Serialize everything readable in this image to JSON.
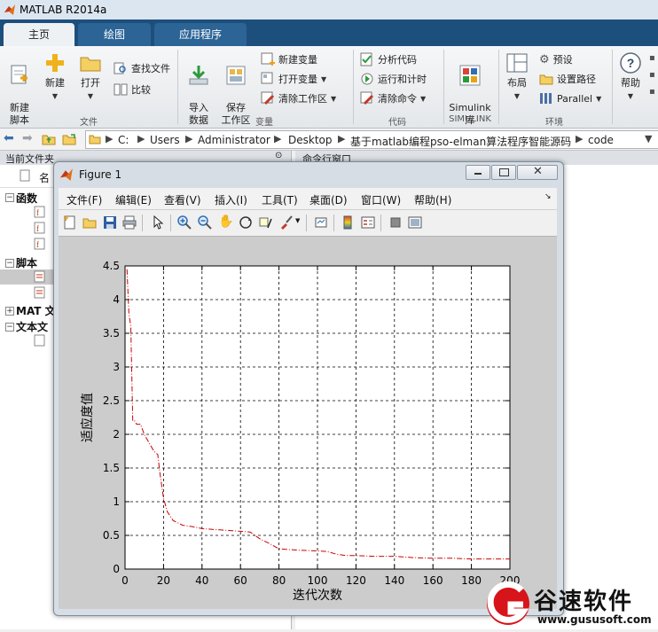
{
  "app": {
    "title": "MATLAB R2014a"
  },
  "tabs": [
    {
      "label": "主页",
      "active": true
    },
    {
      "label": "绘图",
      "active": false
    },
    {
      "label": "应用程序",
      "active": false
    }
  ],
  "ribbon": {
    "file_group": {
      "new_script": "新建\n脚本",
      "new": "新建",
      "open": "打开",
      "find_files": "查找文件",
      "compare": "比较",
      "section": "文件"
    },
    "variable_group": {
      "import_data": "导入\n数据",
      "save_workspace": "保存\n工作区",
      "new_variable": "新建变量",
      "open_variable": "打开变量",
      "clear_workspace": "清除工作区",
      "section": "变量"
    },
    "code_group": {
      "analyze_code": "分析代码",
      "run_and_time": "运行和计时",
      "clear_commands": "清除命令",
      "section": "代码"
    },
    "simulink_group": {
      "simulink": "Simulink\n库",
      "section": "SIMULINK"
    },
    "env_group": {
      "layout": "布局",
      "preferences": "预设",
      "set_path": "设置路径",
      "parallel": "Parallel",
      "section": "环境"
    },
    "help": "帮助"
  },
  "address": {
    "crumbs": [
      "C:",
      "Users",
      "Administrator",
      "Desktop",
      "基于matlab编程pso-elman算法程序智能源码",
      "code"
    ]
  },
  "current_folder": {
    "title": "当前文件夹",
    "column_name": "名",
    "groups": [
      "函数",
      "脚本",
      "MAT 文",
      "文本文"
    ]
  },
  "command_window": {
    "title": "命令行窗口"
  },
  "figure": {
    "title": "Figure 1",
    "menu": [
      "文件(F)",
      "编辑(E)",
      "查看(V)",
      "插入(I)",
      "工具(T)",
      "桌面(D)",
      "窗口(W)",
      "帮助(H)"
    ]
  },
  "chart_data": {
    "type": "line",
    "xlabel": "迭代次数",
    "ylabel": "适应度值",
    "xlim": [
      0,
      200
    ],
    "ylim": [
      0,
      4.5
    ],
    "xticks": [
      0,
      20,
      40,
      60,
      80,
      100,
      120,
      140,
      160,
      180,
      200
    ],
    "yticks": [
      0,
      0.5,
      1,
      1.5,
      2,
      2.5,
      3,
      3.5,
      4,
      4.5
    ],
    "grid": true,
    "line_color": "#cc0000",
    "line_style": "dash-dot",
    "series": [
      {
        "x": [
          1,
          2,
          3,
          4,
          5,
          6,
          8,
          10,
          12,
          15,
          17,
          18,
          20,
          22,
          25,
          30,
          35,
          40,
          50,
          60,
          65,
          70,
          72,
          75,
          80,
          90,
          100,
          105,
          110,
          115,
          120,
          130,
          140,
          150,
          160,
          170,
          180,
          190,
          200
        ],
        "y": [
          4.45,
          3.8,
          3.6,
          2.2,
          2.2,
          2.15,
          2.15,
          2.0,
          1.9,
          1.75,
          1.7,
          1.45,
          1.05,
          0.85,
          0.72,
          0.65,
          0.63,
          0.6,
          0.58,
          0.56,
          0.55,
          0.45,
          0.42,
          0.38,
          0.3,
          0.28,
          0.27,
          0.26,
          0.22,
          0.2,
          0.2,
          0.19,
          0.19,
          0.17,
          0.16,
          0.16,
          0.15,
          0.15,
          0.15
        ]
      }
    ]
  },
  "watermark": {
    "text": "谷速软件",
    "url": "www.gususoft.com"
  },
  "colors": {
    "tab_bar": "#1d4f7d",
    "accent": "#cc0000"
  }
}
